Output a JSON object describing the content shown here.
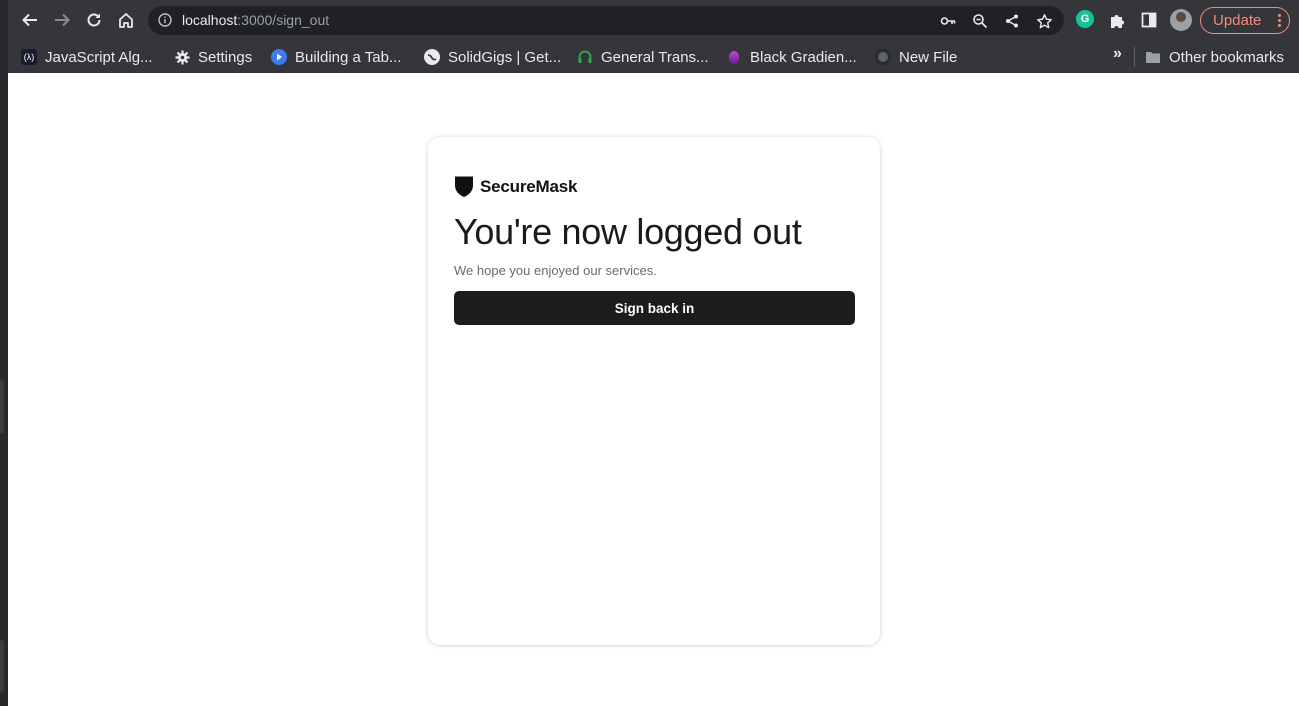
{
  "browser": {
    "url_host": "localhost",
    "url_rest": ":3000/sign_out",
    "update_label": "Update"
  },
  "bookmarks": {
    "items": [
      {
        "label": "JavaScript Alg...",
        "icon": "code-icon"
      },
      {
        "label": "Settings",
        "icon": "gear-icon"
      },
      {
        "label": "Building a Tab...",
        "icon": "play-icon"
      },
      {
        "label": "SolidGigs | Get...",
        "icon": "globe-icon"
      },
      {
        "label": "General Trans...",
        "icon": "headset-icon"
      },
      {
        "label": "Black Gradien...",
        "icon": "gradient-icon"
      },
      {
        "label": "New File",
        "icon": "github-icon"
      }
    ],
    "more": "»",
    "other_label": "Other bookmarks"
  },
  "page": {
    "brand_name": "SecureMask",
    "heading": "You're now logged out",
    "subtext": "We hope you enjoyed our services.",
    "button_label": "Sign back in"
  },
  "colors": {
    "chrome_bg": "#35363a",
    "omnibox_bg": "#202124",
    "button_bg": "#1c1c1c",
    "update_accent": "#f28b82"
  }
}
